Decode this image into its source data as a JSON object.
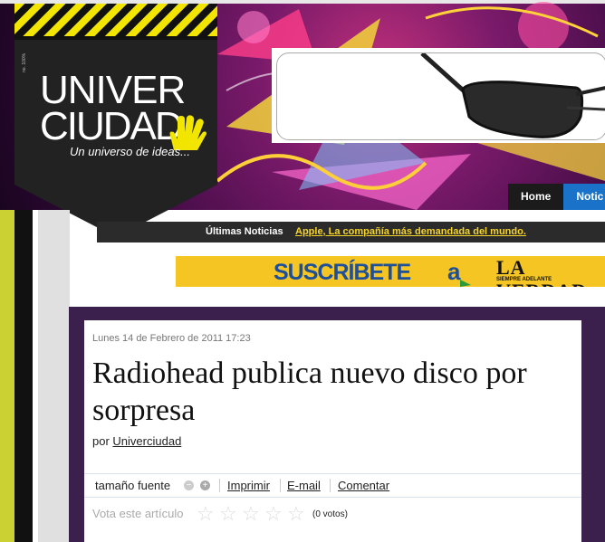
{
  "header": {
    "logo_line1": "UNIVER",
    "logo_line2": "CIUDAD",
    "logo_tagline": "Un universo de ideas...",
    "logo_tiny": "no. 100%"
  },
  "nav": {
    "home": "Home",
    "noticias": "Notic"
  },
  "news_bar": {
    "label": "Últimas Noticias",
    "headline": "Apple, La compañía más demandada del mundo."
  },
  "sub_banner": {
    "text": "SUSCRÍBETE",
    "connector": "a",
    "brand": "LA VERDAD",
    "brand_tagline": "SIEMPRE ADELANTE"
  },
  "article": {
    "date": "Lunes 14 de Febrero de 2011 17:23",
    "title": "Radiohead publica nuevo disco por sorpresa",
    "by_prefix": "por",
    "author": "Univerciudad",
    "font_size_label": "tamaño fuente",
    "dec": "−",
    "inc": "+",
    "print": "Imprimir",
    "email": "E-mail",
    "comment": "Comentar",
    "vote_label": "Vota este artículo",
    "votes": "(0 votos)"
  },
  "colors": {
    "accent_yellow": "#f5c523",
    "nav_blue": "#1a73c8",
    "frame_purple": "#3b1f4d"
  }
}
